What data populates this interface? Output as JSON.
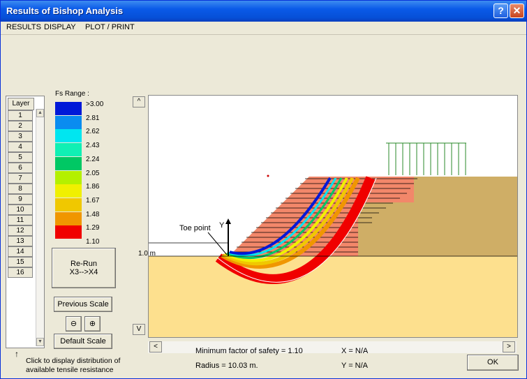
{
  "window": {
    "title": "Results of Bishop Analysis",
    "help_label": "?",
    "close_label": "✕"
  },
  "menu": [
    "RESULTS",
    "DISPLAY",
    "PLOT / PRINT"
  ],
  "layers": {
    "header": "Layer",
    "items": [
      "1",
      "2",
      "3",
      "4",
      "5",
      "6",
      "7",
      "8",
      "9",
      "10",
      "11",
      "12",
      "13",
      "14",
      "15",
      "16"
    ]
  },
  "legend": {
    "title": "Fs  Range :",
    "entries": [
      {
        "label": ">3.00",
        "color": "#0018d8"
      },
      {
        "label": "2.81",
        "color": "#0a8cf0"
      },
      {
        "label": "2.62",
        "color": "#00e6f0"
      },
      {
        "label": "2.43",
        "color": "#10f0b4"
      },
      {
        "label": "2.24",
        "color": "#00c864"
      },
      {
        "label": "2.05",
        "color": "#b4f000"
      },
      {
        "label": "1.86",
        "color": "#f0f000"
      },
      {
        "label": "1.67",
        "color": "#f0c800"
      },
      {
        "label": "1.48",
        "color": "#f09600"
      },
      {
        "label": "1.29",
        "color": "#f00000"
      },
      {
        "label": "1.10",
        "color": "#ffffff"
      }
    ]
  },
  "buttons": {
    "rerun_line1": "Re-Run",
    "rerun_line2": "X3-->X4",
    "previous_scale": "Previous Scale",
    "default_scale": "Default Scale",
    "ok": "OK",
    "scroll_up": "^",
    "scroll_down": "V",
    "scroll_left": "<",
    "scroll_right": ">"
  },
  "hint": {
    "arrow": "↑",
    "text_line1": "Click to display distribution of",
    "text_line2": "available tensile resistance"
  },
  "plot": {
    "toe_label": "Toe point",
    "y_axis_label": "Y",
    "dim_label": "1.0 m"
  },
  "results": {
    "min_fs": "Minimum factor of safety = 1.10",
    "radius": "Radius = 10.03 m.",
    "x": "X = N/A",
    "y": "Y = N/A"
  },
  "colors": {
    "soil_lower": "#fde08e",
    "soil_upper": "#cfae66",
    "reinforced": "#f2876a",
    "load": "#2a8a2a"
  }
}
